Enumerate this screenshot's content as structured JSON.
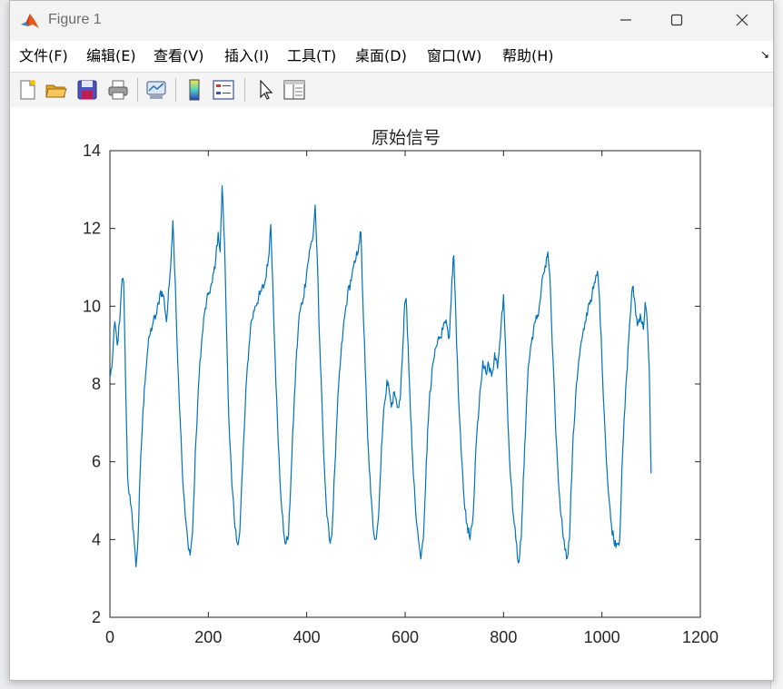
{
  "window": {
    "title": "Figure 1"
  },
  "menu": {
    "items": [
      {
        "label": "文件(F)"
      },
      {
        "label": "编辑(E)"
      },
      {
        "label": "查看(V)"
      },
      {
        "label": "插入(I)"
      },
      {
        "label": "工具(T)"
      },
      {
        "label": "桌面(D)"
      },
      {
        "label": "窗口(W)"
      },
      {
        "label": "帮助(H)"
      }
    ]
  },
  "toolbar": {
    "tools": [
      "new-figure-icon",
      "open-file-icon",
      "save-icon",
      "print-icon",
      "link-plot-icon",
      "colorbar-icon",
      "legend-icon",
      "pointer-icon",
      "property-editor-icon"
    ]
  },
  "colors": {
    "line": "#0072bd",
    "axes": "#262626"
  },
  "chart_data": {
    "type": "line",
    "title": "原始信号",
    "xlim": [
      0,
      1200
    ],
    "ylim": [
      2,
      14
    ],
    "xticks": [
      0,
      200,
      400,
      600,
      800,
      1000,
      1200
    ],
    "yticks": [
      2,
      4,
      6,
      8,
      10,
      12,
      14
    ],
    "grid": false,
    "x_range": [
      1,
      1100
    ],
    "series": [
      {
        "color": "#0072bd",
        "points": [
          [
            1,
            8.2
          ],
          [
            5,
            8.6
          ],
          [
            10,
            9.6
          ],
          [
            15,
            9.0
          ],
          [
            20,
            9.6
          ],
          [
            25,
            10.7
          ],
          [
            28,
            10.6
          ],
          [
            32,
            8.0
          ],
          [
            36,
            5.6
          ],
          [
            42,
            4.9
          ],
          [
            48,
            4.2
          ],
          [
            53,
            3.3
          ],
          [
            57,
            4.0
          ],
          [
            63,
            6.2
          ],
          [
            70,
            7.9
          ],
          [
            76,
            8.8
          ],
          [
            80,
            9.2
          ],
          [
            88,
            9.6
          ],
          [
            95,
            9.8
          ],
          [
            103,
            10.4
          ],
          [
            110,
            10.2
          ],
          [
            115,
            9.6
          ],
          [
            122,
            10.8
          ],
          [
            128,
            12.2
          ],
          [
            133,
            10.6
          ],
          [
            138,
            8.5
          ],
          [
            143,
            7.0
          ],
          [
            148,
            5.5
          ],
          [
            153,
            4.6
          ],
          [
            158,
            4.0
          ],
          [
            163,
            3.6
          ],
          [
            168,
            4.2
          ],
          [
            175,
            6.6
          ],
          [
            183,
            8.6
          ],
          [
            192,
            9.8
          ],
          [
            200,
            10.3
          ],
          [
            208,
            10.6
          ],
          [
            215,
            11.2
          ],
          [
            220,
            11.9
          ],
          [
            224,
            11.4
          ],
          [
            228,
            13.1
          ],
          [
            233,
            11.6
          ],
          [
            237,
            9.4
          ],
          [
            242,
            7.0
          ],
          [
            248,
            5.4
          ],
          [
            254,
            4.3
          ],
          [
            259,
            3.9
          ],
          [
            264,
            4.2
          ],
          [
            270,
            6.0
          ],
          [
            278,
            8.2
          ],
          [
            286,
            9.5
          ],
          [
            295,
            10.0
          ],
          [
            305,
            10.3
          ],
          [
            315,
            10.6
          ],
          [
            322,
            11.2
          ],
          [
            327,
            12.1
          ],
          [
            331,
            10.6
          ],
          [
            336,
            8.6
          ],
          [
            342,
            6.5
          ],
          [
            348,
            5.0
          ],
          [
            353,
            4.2
          ],
          [
            358,
            3.9
          ],
          [
            363,
            4.1
          ],
          [
            370,
            6.2
          ],
          [
            378,
            8.5
          ],
          [
            385,
            9.8
          ],
          [
            393,
            10.2
          ],
          [
            400,
            10.9
          ],
          [
            407,
            11.5
          ],
          [
            413,
            11.8
          ],
          [
            417,
            12.6
          ],
          [
            421,
            11.4
          ],
          [
            425,
            9.5
          ],
          [
            431,
            7.5
          ],
          [
            436,
            5.8
          ],
          [
            441,
            4.6
          ],
          [
            446,
            4.0
          ],
          [
            451,
            4.1
          ],
          [
            457,
            5.8
          ],
          [
            465,
            8.0
          ],
          [
            474,
            9.4
          ],
          [
            483,
            10.3
          ],
          [
            492,
            10.8
          ],
          [
            500,
            11.2
          ],
          [
            506,
            11.6
          ],
          [
            510,
            11.9
          ],
          [
            514,
            10.2
          ],
          [
            519,
            8.4
          ],
          [
            524,
            6.6
          ],
          [
            530,
            5.2
          ],
          [
            535,
            4.3
          ],
          [
            540,
            4.0
          ],
          [
            546,
            4.6
          ],
          [
            552,
            6.4
          ],
          [
            558,
            7.5
          ],
          [
            563,
            8.1
          ],
          [
            567,
            7.9
          ],
          [
            572,
            7.4
          ],
          [
            578,
            7.8
          ],
          [
            584,
            7.4
          ],
          [
            590,
            7.6
          ],
          [
            594,
            8.6
          ],
          [
            598,
            9.8
          ],
          [
            602,
            10.2
          ],
          [
            606,
            9.0
          ],
          [
            611,
            7.2
          ],
          [
            617,
            5.6
          ],
          [
            622,
            4.6
          ],
          [
            627,
            4.0
          ],
          [
            632,
            3.5
          ],
          [
            637,
            4.0
          ],
          [
            643,
            6.0
          ],
          [
            650,
            7.8
          ],
          [
            658,
            8.6
          ],
          [
            665,
            9.0
          ],
          [
            672,
            9.2
          ],
          [
            680,
            9.6
          ],
          [
            685,
            9.5
          ],
          [
            690,
            9.2
          ],
          [
            695,
            10.7
          ],
          [
            699,
            11.3
          ],
          [
            703,
            9.8
          ],
          [
            708,
            7.8
          ],
          [
            714,
            6.2
          ],
          [
            720,
            5.0
          ],
          [
            726,
            4.4
          ],
          [
            732,
            4.0
          ],
          [
            738,
            4.6
          ],
          [
            744,
            6.4
          ],
          [
            752,
            7.8
          ],
          [
            758,
            8.6
          ],
          [
            764,
            8.3
          ],
          [
            770,
            8.5
          ],
          [
            776,
            8.2
          ],
          [
            782,
            8.8
          ],
          [
            788,
            8.4
          ],
          [
            795,
            9.5
          ],
          [
            800,
            10.3
          ],
          [
            804,
            9.0
          ],
          [
            809,
            7.0
          ],
          [
            815,
            5.5
          ],
          [
            820,
            4.6
          ],
          [
            825,
            4.0
          ],
          [
            830,
            3.4
          ],
          [
            836,
            4.0
          ],
          [
            843,
            6.4
          ],
          [
            850,
            8.4
          ],
          [
            858,
            9.2
          ],
          [
            865,
            9.6
          ],
          [
            872,
            9.9
          ],
          [
            880,
            10.8
          ],
          [
            886,
            11.0
          ],
          [
            890,
            11.4
          ],
          [
            894,
            10.8
          ],
          [
            899,
            9.0
          ],
          [
            905,
            7.2
          ],
          [
            911,
            5.6
          ],
          [
            917,
            4.6
          ],
          [
            923,
            4.0
          ],
          [
            928,
            3.5
          ],
          [
            934,
            4.0
          ],
          [
            940,
            6.2
          ],
          [
            948,
            8.0
          ],
          [
            956,
            8.9
          ],
          [
            964,
            9.4
          ],
          [
            972,
            10.0
          ],
          [
            980,
            10.3
          ],
          [
            986,
            10.6
          ],
          [
            991,
            10.9
          ],
          [
            995,
            10.2
          ],
          [
            1000,
            8.6
          ],
          [
            1006,
            6.9
          ],
          [
            1012,
            5.4
          ],
          [
            1018,
            4.5
          ],
          [
            1024,
            4.0
          ],
          [
            1030,
            3.9
          ],
          [
            1036,
            4.0
          ],
          [
            1042,
            6.2
          ],
          [
            1050,
            8.2
          ],
          [
            1056,
            9.5
          ],
          [
            1062,
            10.5
          ],
          [
            1066,
            10.2
          ],
          [
            1072,
            9.5
          ],
          [
            1078,
            9.8
          ],
          [
            1084,
            9.4
          ],
          [
            1088,
            10.1
          ],
          [
            1092,
            9.6
          ],
          [
            1096,
            8.4
          ],
          [
            1100,
            5.7
          ]
        ]
      }
    ]
  }
}
